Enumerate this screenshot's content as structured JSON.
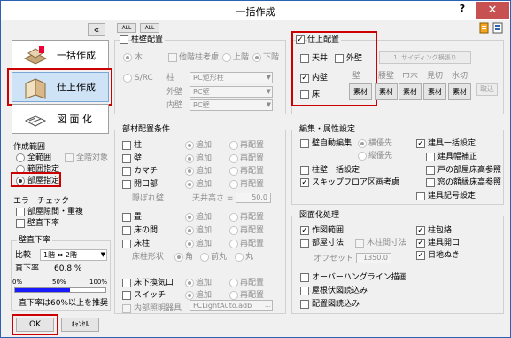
{
  "window": {
    "title": "一括作成",
    "help_label": "?",
    "close_label": "✕"
  },
  "collapse_label": "«",
  "toolbar": {
    "check_all": "ALL",
    "uncheck_all": "ALL"
  },
  "big_buttons": [
    {
      "label": "一括作成"
    },
    {
      "label": "仕上作成",
      "selected": true
    },
    {
      "label": "図 面 化"
    }
  ],
  "range": {
    "title": "作成範囲",
    "options": [
      "全範囲",
      "範囲指定",
      "部屋指定"
    ],
    "selected": 2,
    "all_targets_label": "全階対象"
  },
  "error_check": {
    "title": "エラーチェック",
    "items": [
      "部屋隙間・重複",
      "壁直下率"
    ]
  },
  "wall_ratio": {
    "title": "壁直下率",
    "compare_label": "比較",
    "compare_value": "1階 ⇔ 2階",
    "ratio_label": "直下率",
    "ratio_value": "60.8 %",
    "progress": 0.608,
    "scale": [
      "0%",
      "50%",
      "100%"
    ],
    "note": "直下率は60%以上を推奨"
  },
  "buttons": {
    "ok": "OK",
    "cancel": "ｷｬﾝｾﾙ"
  },
  "pillar": {
    "title": "柱壁配置",
    "material_options": [
      "木",
      "S/RC"
    ],
    "other_floor": "他階柱考慮",
    "upper": "上階",
    "lower": "下階",
    "pillar_label": "柱",
    "pillar_value": "RC矩形柱",
    "outer_wall_label": "外壁",
    "outer_wall_value": "RC壁",
    "inner_wall_label": "内壁",
    "inner_wall_value": "RC壁"
  },
  "parts": {
    "title": "部材配置条件",
    "add": "追加",
    "reposition": "再配置",
    "rows": [
      "柱",
      "壁",
      "カマチ",
      "開口部",
      "畳",
      "床の間",
      "床柱",
      "床下換気口",
      "スイッチ",
      "内部照明器具"
    ],
    "hidden_wall_label": "隠ぼれ壁",
    "ceiling_height_label": "天井高さ =",
    "ceiling_height_value": "50.0",
    "floor_post_shape_label": "床柱形状",
    "shape_options": [
      "角",
      "前丸",
      "丸"
    ],
    "fixture_value": "FCLightAuto.adb"
  },
  "finish": {
    "title": "仕上配置",
    "items": [
      "天井",
      "内壁",
      "床"
    ],
    "outer_wall": "外壁",
    "siding_button": "1. サイディング横張り",
    "column_headers": [
      "壁",
      "腰壁",
      "巾木",
      "見切",
      "水切"
    ],
    "material_label": "素材",
    "take_in": "取込"
  },
  "edit": {
    "title": "編集・属性設定",
    "wall_auto_edit": "壁自動編集",
    "horizontal_first": "横優先",
    "vertical_first": "縦優先",
    "pillar_wall_bulk": "柱壁一括設定",
    "skip_floor": "スキップフロア区画考慮",
    "fixture_bulk": "建具一括設定",
    "fixture_width_fix": "建具幅補正",
    "door_room_floor_height": "戸の部屋床高参照",
    "window_trim_floor_height": "窓の額縁床高参照",
    "fixture_symbol": "建具記号設定"
  },
  "drawing": {
    "title": "図面化処理",
    "drawing_range": "作図範囲",
    "room_dims": "部屋寸法",
    "wood_column_dims": "木柱間寸法",
    "offset_label": "オフセット",
    "offset_value": "1350.0",
    "column_wrap": "柱包絡",
    "fixture_opening": "建具開口",
    "visual_check": "目地ぬき",
    "overhang_line": "オーバーハングライン描画",
    "roof_plan_import": "屋根伏図読込み",
    "layout_plan_import": "配置図読込み"
  },
  "colors": {
    "highlight": "#cc0000",
    "accent": "#2c62b4",
    "progress": "#1a1aff"
  }
}
